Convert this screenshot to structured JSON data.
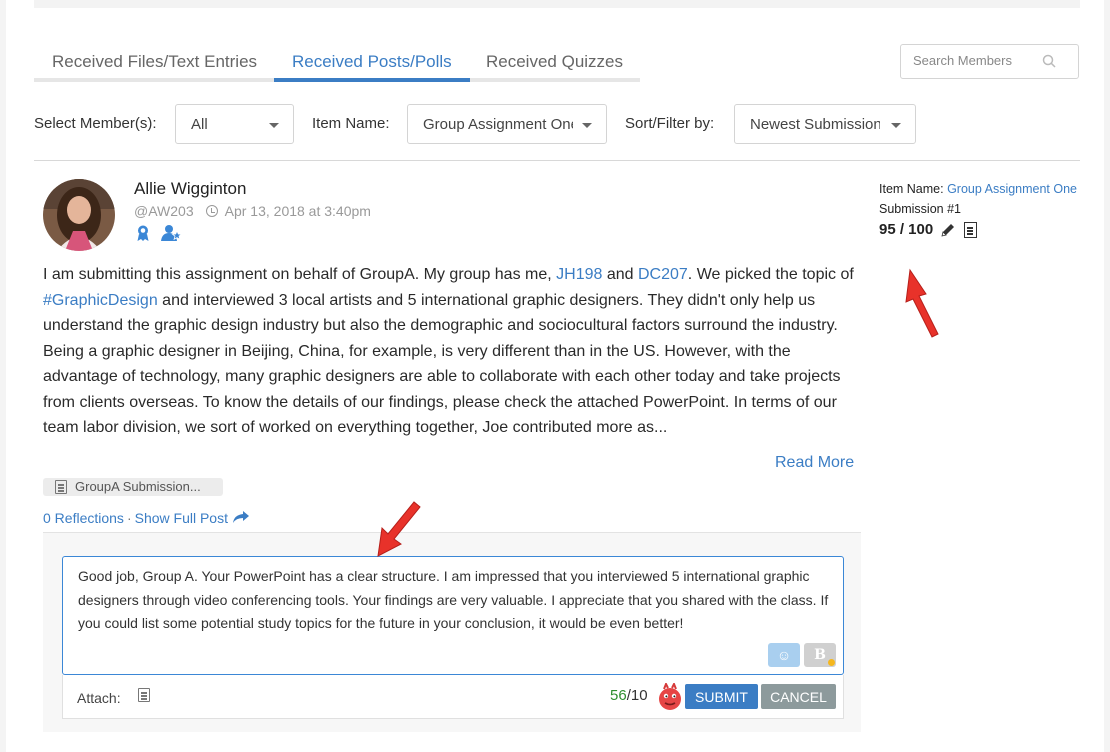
{
  "tabs": [
    {
      "label": "Received Files/Text Entries",
      "active": false
    },
    {
      "label": "Received Posts/Polls",
      "active": true
    },
    {
      "label": "Received Quizzes",
      "active": false
    }
  ],
  "search": {
    "placeholder": "Search Members"
  },
  "filters": {
    "member_label": "Select Member(s):",
    "member_value": "All",
    "item_label": "Item Name:",
    "item_value": "Group Assignment One",
    "sort_label": "Sort/Filter by:",
    "sort_value": "Newest Submission"
  },
  "post": {
    "author": "Allie Wigginton",
    "handle": "@AW203",
    "date": "Apr 13, 2018 at 3:40pm",
    "body_p1": "I am submitting this assignment on behalf of GroupA. My group has me, ",
    "mention1": "JH198",
    "body_and": " and ",
    "mention2": "DC207",
    "body_p2": ". We picked the topic of ",
    "hashtag": "#GraphicDesign",
    "body_p3": " and interviewed 3 local artists and 5 international graphic designers. They didn't only help us understand the graphic design industry but also the demographic and sociocultural factors surround the industry. Being a graphic designer in Beijing, China, for example, is very different than in the US. However, with the advantage of technology, many graphic designers are able to collaborate with each other today and take projects from clients overseas. To know the details of our findings, please check the attached PowerPoint. In terms of our team labor division, we sort of worked on everything together, Joe contributed more as...",
    "read_more": "Read More",
    "attachment": "GroupA Submission...",
    "reflections": "0 Reflections",
    "separator": "·",
    "show_full": "Show Full Post"
  },
  "comment": {
    "text": "Good job, Group A. Your PowerPoint has a clear structure. I am impressed that you interviewed 5 international graphic designers through video conferencing tools. Your findings are very valuable. I appreciate that you shared with the class. If you could list some potential study topics for the future in your conclusion, it would be even better!",
    "emoji_glyph": "☺",
    "bold_glyph": "B",
    "attach_label": "Attach:",
    "count": "56",
    "count_max": "/10",
    "submit": "SUBMIT",
    "cancel": "CANCEL"
  },
  "side": {
    "item_label": "Item Name: ",
    "item_link": "Group Assignment One",
    "submission": "Submission #1",
    "score": "95 / 100"
  },
  "colors": {
    "accent": "#3b7dc4",
    "cancel": "#8d9a9c",
    "arrow": "#e8322a",
    "count_ok": "#2f8f2f"
  }
}
